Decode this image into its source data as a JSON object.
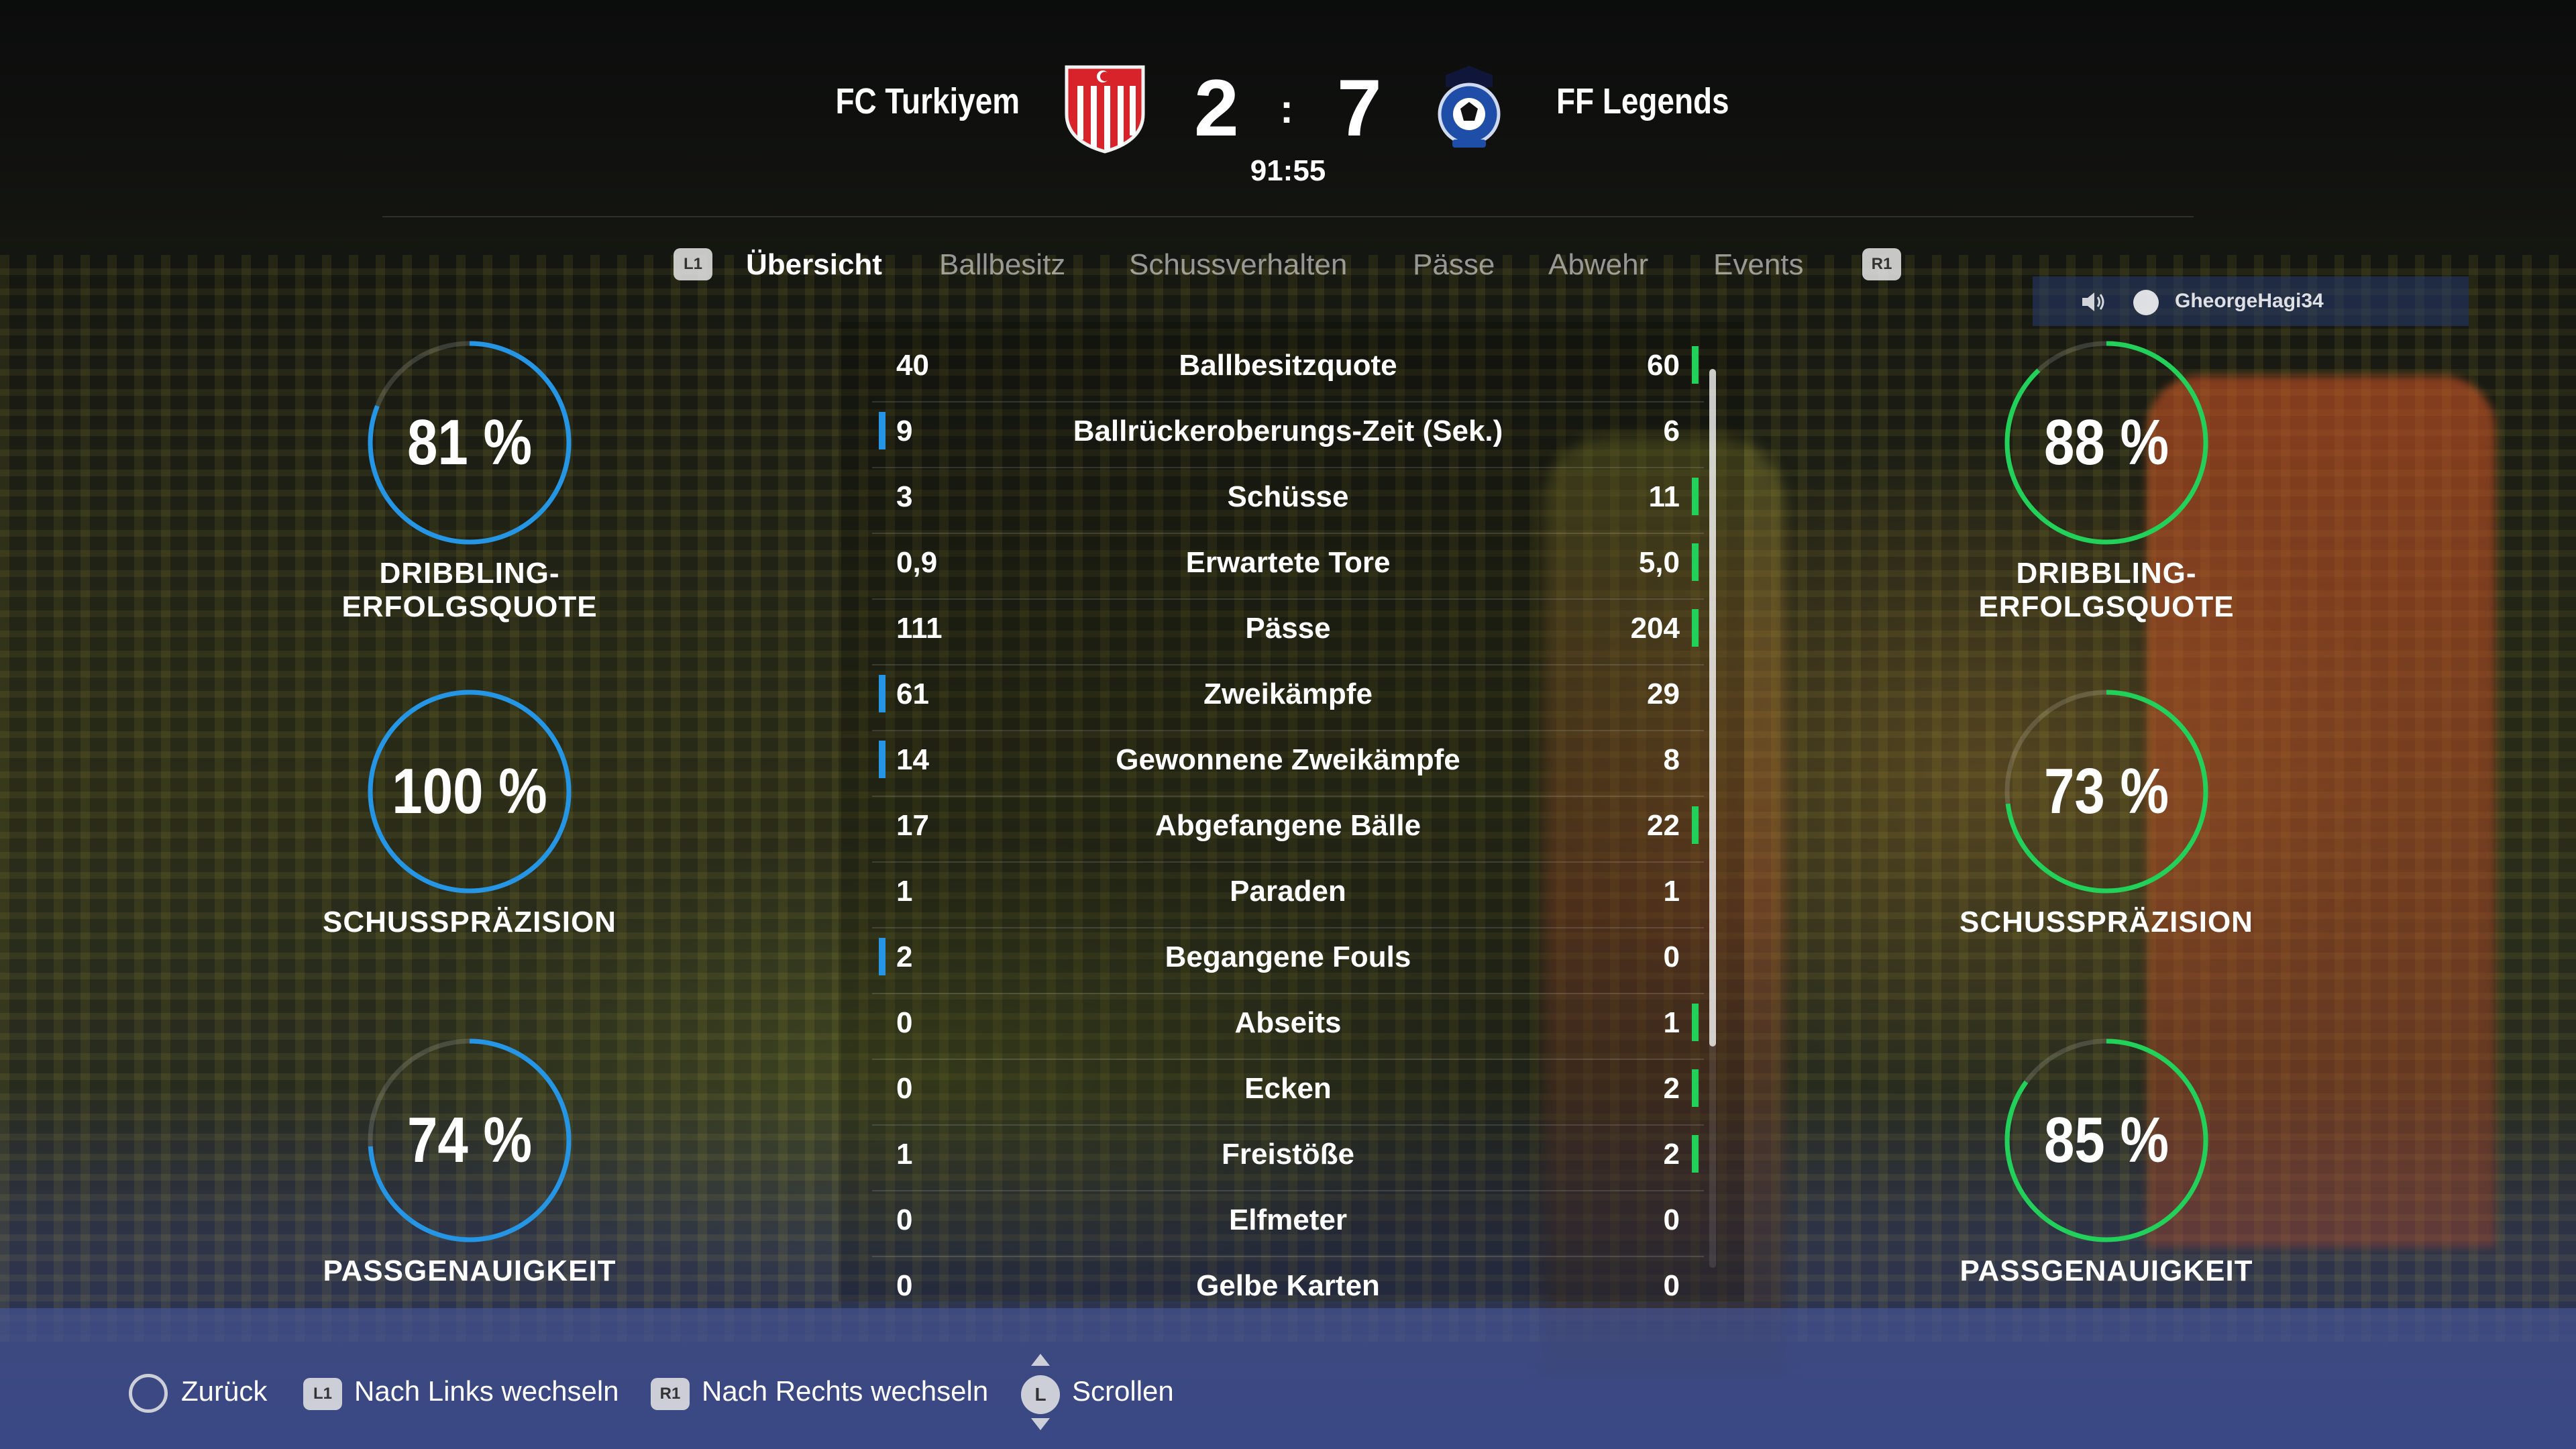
{
  "header": {
    "home_team": "FC Turkiyem",
    "away_team": "FF Legends",
    "home_score": "2",
    "away_score": "7",
    "separator": ":",
    "clock": "91:55"
  },
  "tabs": {
    "left_button": "L1",
    "right_button": "R1",
    "items": [
      "Übersicht",
      "Ballbesitz",
      "Schussverhalten",
      "Pässe",
      "Abwehr",
      "Events"
    ],
    "active_index": 0
  },
  "player_tag": {
    "name": "GheorgeHagi34"
  },
  "home_rings": [
    {
      "value": "81 %",
      "pct": 81,
      "label": "DRIBBLING-ERFOLGSQUOTE"
    },
    {
      "value": "100 %",
      "pct": 100,
      "label": "SCHUSSPRÄZISION"
    },
    {
      "value": "74 %",
      "pct": 74,
      "label": "PASSGENAUIGKEIT"
    }
  ],
  "away_rings": [
    {
      "value": "88 %",
      "pct": 88,
      "label": "DRIBBLING-ERFOLGSQUOTE"
    },
    {
      "value": "73 %",
      "pct": 73,
      "label": "SCHUSSPRÄZISION"
    },
    {
      "value": "85 %",
      "pct": 85,
      "label": "PASSGENAUIGKEIT"
    }
  ],
  "stats": [
    {
      "home": "40",
      "label": "Ballbesitzquote",
      "away": "60",
      "lead": "away"
    },
    {
      "home": "9",
      "label": "Ballrückeroberungs-Zeit (Sek.)",
      "away": "6",
      "lead": "home"
    },
    {
      "home": "3",
      "label": "Schüsse",
      "away": "11",
      "lead": "away"
    },
    {
      "home": "0,9",
      "label": "Erwartete Tore",
      "away": "5,0",
      "lead": "away"
    },
    {
      "home": "111",
      "label": "Pässe",
      "away": "204",
      "lead": "away"
    },
    {
      "home": "61",
      "label": "Zweikämpfe",
      "away": "29",
      "lead": "home"
    },
    {
      "home": "14",
      "label": "Gewonnene Zweikämpfe",
      "away": "8",
      "lead": "home"
    },
    {
      "home": "17",
      "label": "Abgefangene Bälle",
      "away": "22",
      "lead": "away"
    },
    {
      "home": "1",
      "label": "Paraden",
      "away": "1",
      "lead": "none"
    },
    {
      "home": "2",
      "label": "Begangene Fouls",
      "away": "0",
      "lead": "home"
    },
    {
      "home": "0",
      "label": "Abseits",
      "away": "1",
      "lead": "away"
    },
    {
      "home": "0",
      "label": "Ecken",
      "away": "2",
      "lead": "away"
    },
    {
      "home": "1",
      "label": "Freistöße",
      "away": "2",
      "lead": "away"
    },
    {
      "home": "0",
      "label": "Elfmeter",
      "away": "0",
      "lead": "none"
    },
    {
      "home": "0",
      "label": "Gelbe Karten",
      "away": "0",
      "lead": "none"
    }
  ],
  "colors": {
    "home": "#2596e6",
    "away": "#21d15a"
  },
  "footer": {
    "back": "Zurück",
    "l1": "L1",
    "left": "Nach Links wechseln",
    "r1": "R1",
    "right": "Nach Rechts wechseln",
    "stick": "L",
    "scroll": "Scrollen"
  }
}
